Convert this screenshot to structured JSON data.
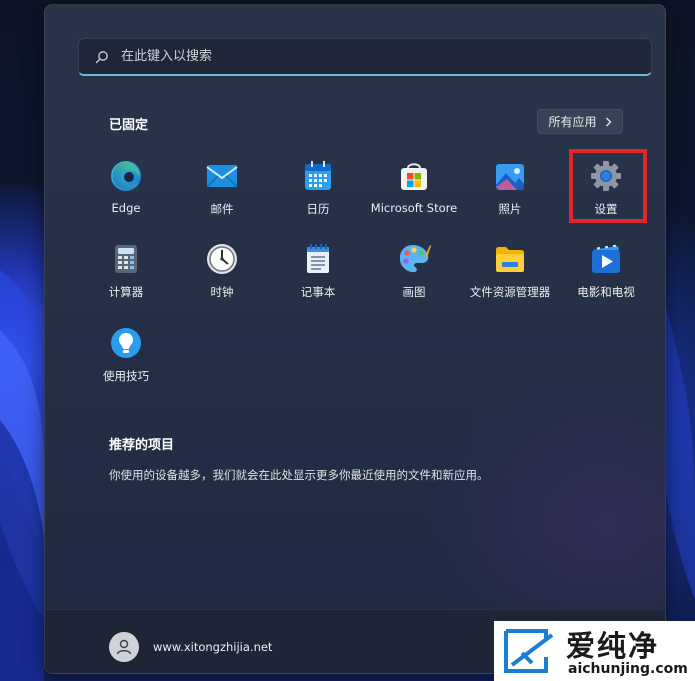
{
  "search": {
    "placeholder": "在此键入以搜索"
  },
  "pinned": {
    "title": "已固定",
    "all_apps_label": "所有应用",
    "apps": [
      {
        "label": "Edge",
        "icon": "edge-icon"
      },
      {
        "label": "邮件",
        "icon": "mail-icon"
      },
      {
        "label": "日历",
        "icon": "calendar-icon"
      },
      {
        "label": "Microsoft Store",
        "icon": "store-icon"
      },
      {
        "label": "照片",
        "icon": "photos-icon"
      },
      {
        "label": "设置",
        "icon": "gear-icon"
      },
      {
        "label": "计算器",
        "icon": "calculator-icon"
      },
      {
        "label": "时钟",
        "icon": "clock-icon"
      },
      {
        "label": "记事本",
        "icon": "notepad-icon"
      },
      {
        "label": "画图",
        "icon": "paint-icon"
      },
      {
        "label": "文件资源管理器",
        "icon": "folder-icon"
      },
      {
        "label": "电影和电视",
        "icon": "movies-icon"
      },
      {
        "label": "使用技巧",
        "icon": "tips-icon"
      }
    ]
  },
  "recommended": {
    "title": "推荐的项目",
    "description": "你使用的设备越多，我们就会在此处显示更多你最近使用的文件和新应用。"
  },
  "user": {
    "name": "www.xitongzhijia.net"
  },
  "watermark": {
    "title": "爱纯净",
    "url": "aichunjing.com"
  },
  "colors": {
    "highlight": "#e0282c",
    "search_underline": "#6ab9e6",
    "accent": "#0078d4"
  }
}
